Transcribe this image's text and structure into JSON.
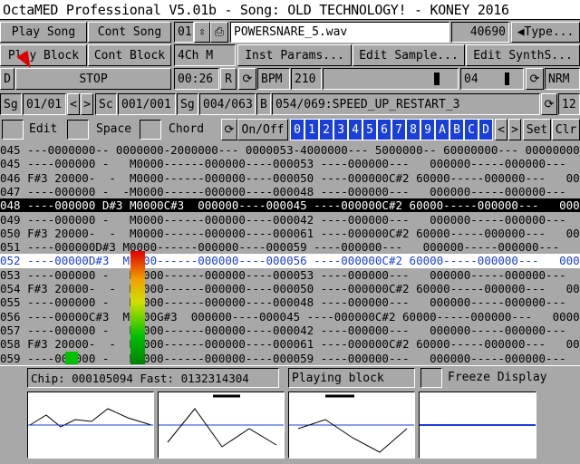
{
  "title": "OctaMED Professional V5.01b - Song: OLD TECHNOLOGY! - KONEY 2016",
  "buttons": {
    "play_song": "Play Song",
    "cont_song": "Cont Song",
    "play_block": "Play Block",
    "cont_block": "Cont Block",
    "stop": "STOP",
    "d": "D",
    "inst_params": "Inst Params...",
    "edit_sample": "Edit Sample...",
    "edit_synth": "Edit SynthS...",
    "type": "Type...",
    "nrm": "NRM",
    "r": "R",
    "bpm_label": "BPM",
    "set": "Set",
    "clr": "Clr",
    "onoff": "On/Off",
    "sg": "Sg",
    "sc": "Sc",
    "b": "B"
  },
  "instrument": {
    "number": "01",
    "name": "POWERSNARE_5.wav",
    "size": "40690"
  },
  "channels": "4Ch M",
  "time": "00:26",
  "bpm": "210",
  "octave": "04",
  "song_pos": {
    "sg1": "01/01",
    "sc": "001/001",
    "sg2": "004/063",
    "block": "054/069:SPEED_UP_RESTART_3",
    "lines": "12"
  },
  "toggles": {
    "edit": "Edit",
    "space": "Space",
    "chord": "Chord"
  },
  "tracks": [
    "0",
    "1",
    "2",
    "3",
    "4",
    "5",
    "6",
    "7",
    "8",
    "9",
    "A",
    "B",
    "C",
    "D"
  ],
  "status": {
    "memory": "Chip: 000105094 Fast: 0132314304",
    "mode": "Playing block",
    "freeze": "Freeze Display"
  },
  "pattern": {
    "header": "045 ---0000000-- 0000000-2000000--- 0000053-4000000--- 5000000-- 60000000--- 00000000",
    "rows": [
      "045 ----000000 -   M0000------000000----000053 ----000000---   000000-----000000---   00000",
      "046 F#3 20000-  -  M0000------000000----000050 ----000000C#2 60000-----000000---   00000",
      "047 ----000000 -  -M0000------000000----000048 ----000000---   000000-----000000---   00000",
      "048 ----000000 D#3 M0000C#3  000000----000045 ----000000C#2 60000-----000000---   00000",
      "049 ----000000 -   M0000------000000----000042 ----000000---   000000-----000000---   00000",
      "050 F#3 20000-  -  M0000------000000----000061 ----000000C#2 60000-----000000---   00000",
      "051 ----000000D#3 M0000------000000----000059 ----000000---   000000-----000000---   00000",
      "052 ----00000D#3  M0000------000000----000056 ----000000C#2 60000-----000000---   00000",
      "053 ----000000 -   M0000------000000----000053 ----000000---   000000-----000000---   00000",
      "054 F#3 20000-  -  M0000------000000----000050 ----000000C#2 60000-----000000---   00000",
      "055 ----000000 -   M0000------000000----000048 ----000000---   000000-----000000---   00000",
      "056 ----00000C#3  M0000G#3  000000----000045 ----000000C#2 60000-----000000---   00000",
      "057 ----000000 -   M0000------000000----000042 ----000000---   000000-----000000---   00000",
      "058 F#3 20000-  -  M0000------000000----000061 ----000000C#2 60000-----000000---   00000",
      "059 ----000000 -   M0000------000000----000059 ----000000---   000000-----000000---   00000"
    ],
    "highlight_row": 3,
    "cursor_row": 7
  }
}
